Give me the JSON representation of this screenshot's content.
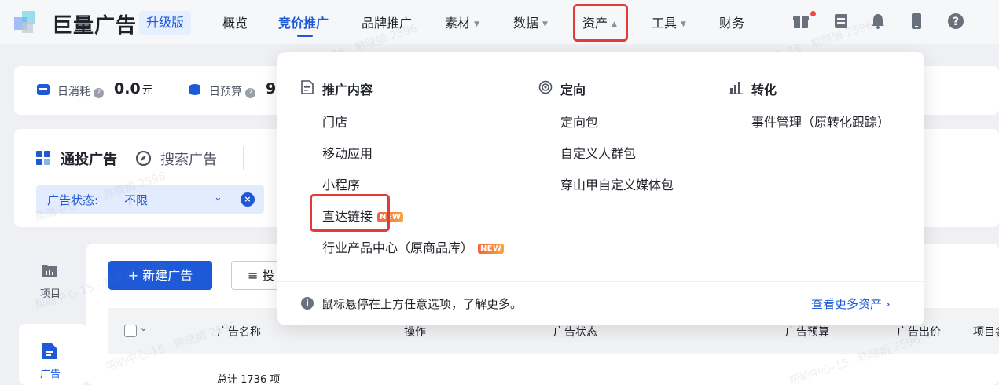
{
  "header": {
    "logo_text": "巨量广告",
    "upgrade_badge": "升级版",
    "nav": [
      "概览",
      "竞价推广",
      "品牌推广",
      "素材",
      "数据",
      "资产",
      "工具",
      "财务"
    ]
  },
  "stats": {
    "daily_cost_label": "日消耗",
    "daily_cost_value": "0.0",
    "daily_cost_unit": "元",
    "daily_budget_label": "日预算",
    "daily_budget_value": "9"
  },
  "tabs": {
    "tongtou": "通投广告",
    "search": "搜索广告"
  },
  "filter": {
    "label": "广告状态:",
    "value": "不限"
  },
  "sidebar": {
    "project": "项目",
    "ad": "广告"
  },
  "toolbar": {
    "new_ad": "+ 新建广告",
    "tou": "≡ 投"
  },
  "table": {
    "headers": [
      "广告名称",
      "操作",
      "广告状态",
      "广告预算",
      "广告出价",
      "项目名"
    ],
    "total": "总计 1736 项"
  },
  "dropdown": {
    "col1": {
      "title": "推广内容",
      "items": [
        "门店",
        "移动应用",
        "小程序",
        "直达链接",
        "行业产品中心（原商品库）"
      ]
    },
    "col2": {
      "title": "定向",
      "items": [
        "定向包",
        "自定义人群包",
        "穿山甲自定义媒体包"
      ]
    },
    "col3": {
      "title": "转化",
      "items": [
        "事件管理（原转化跟踪）"
      ]
    },
    "new_tag": "NEW",
    "footer_text": "鼠标悬停在上方任意选项，了解更多。",
    "footer_link": "查看更多资产 ›"
  },
  "watermark": "帮助中心-15 · 熊晓娟 2596",
  "colors": {
    "accent": "#1e5ad7",
    "highlight_box": "#e23b3b"
  }
}
